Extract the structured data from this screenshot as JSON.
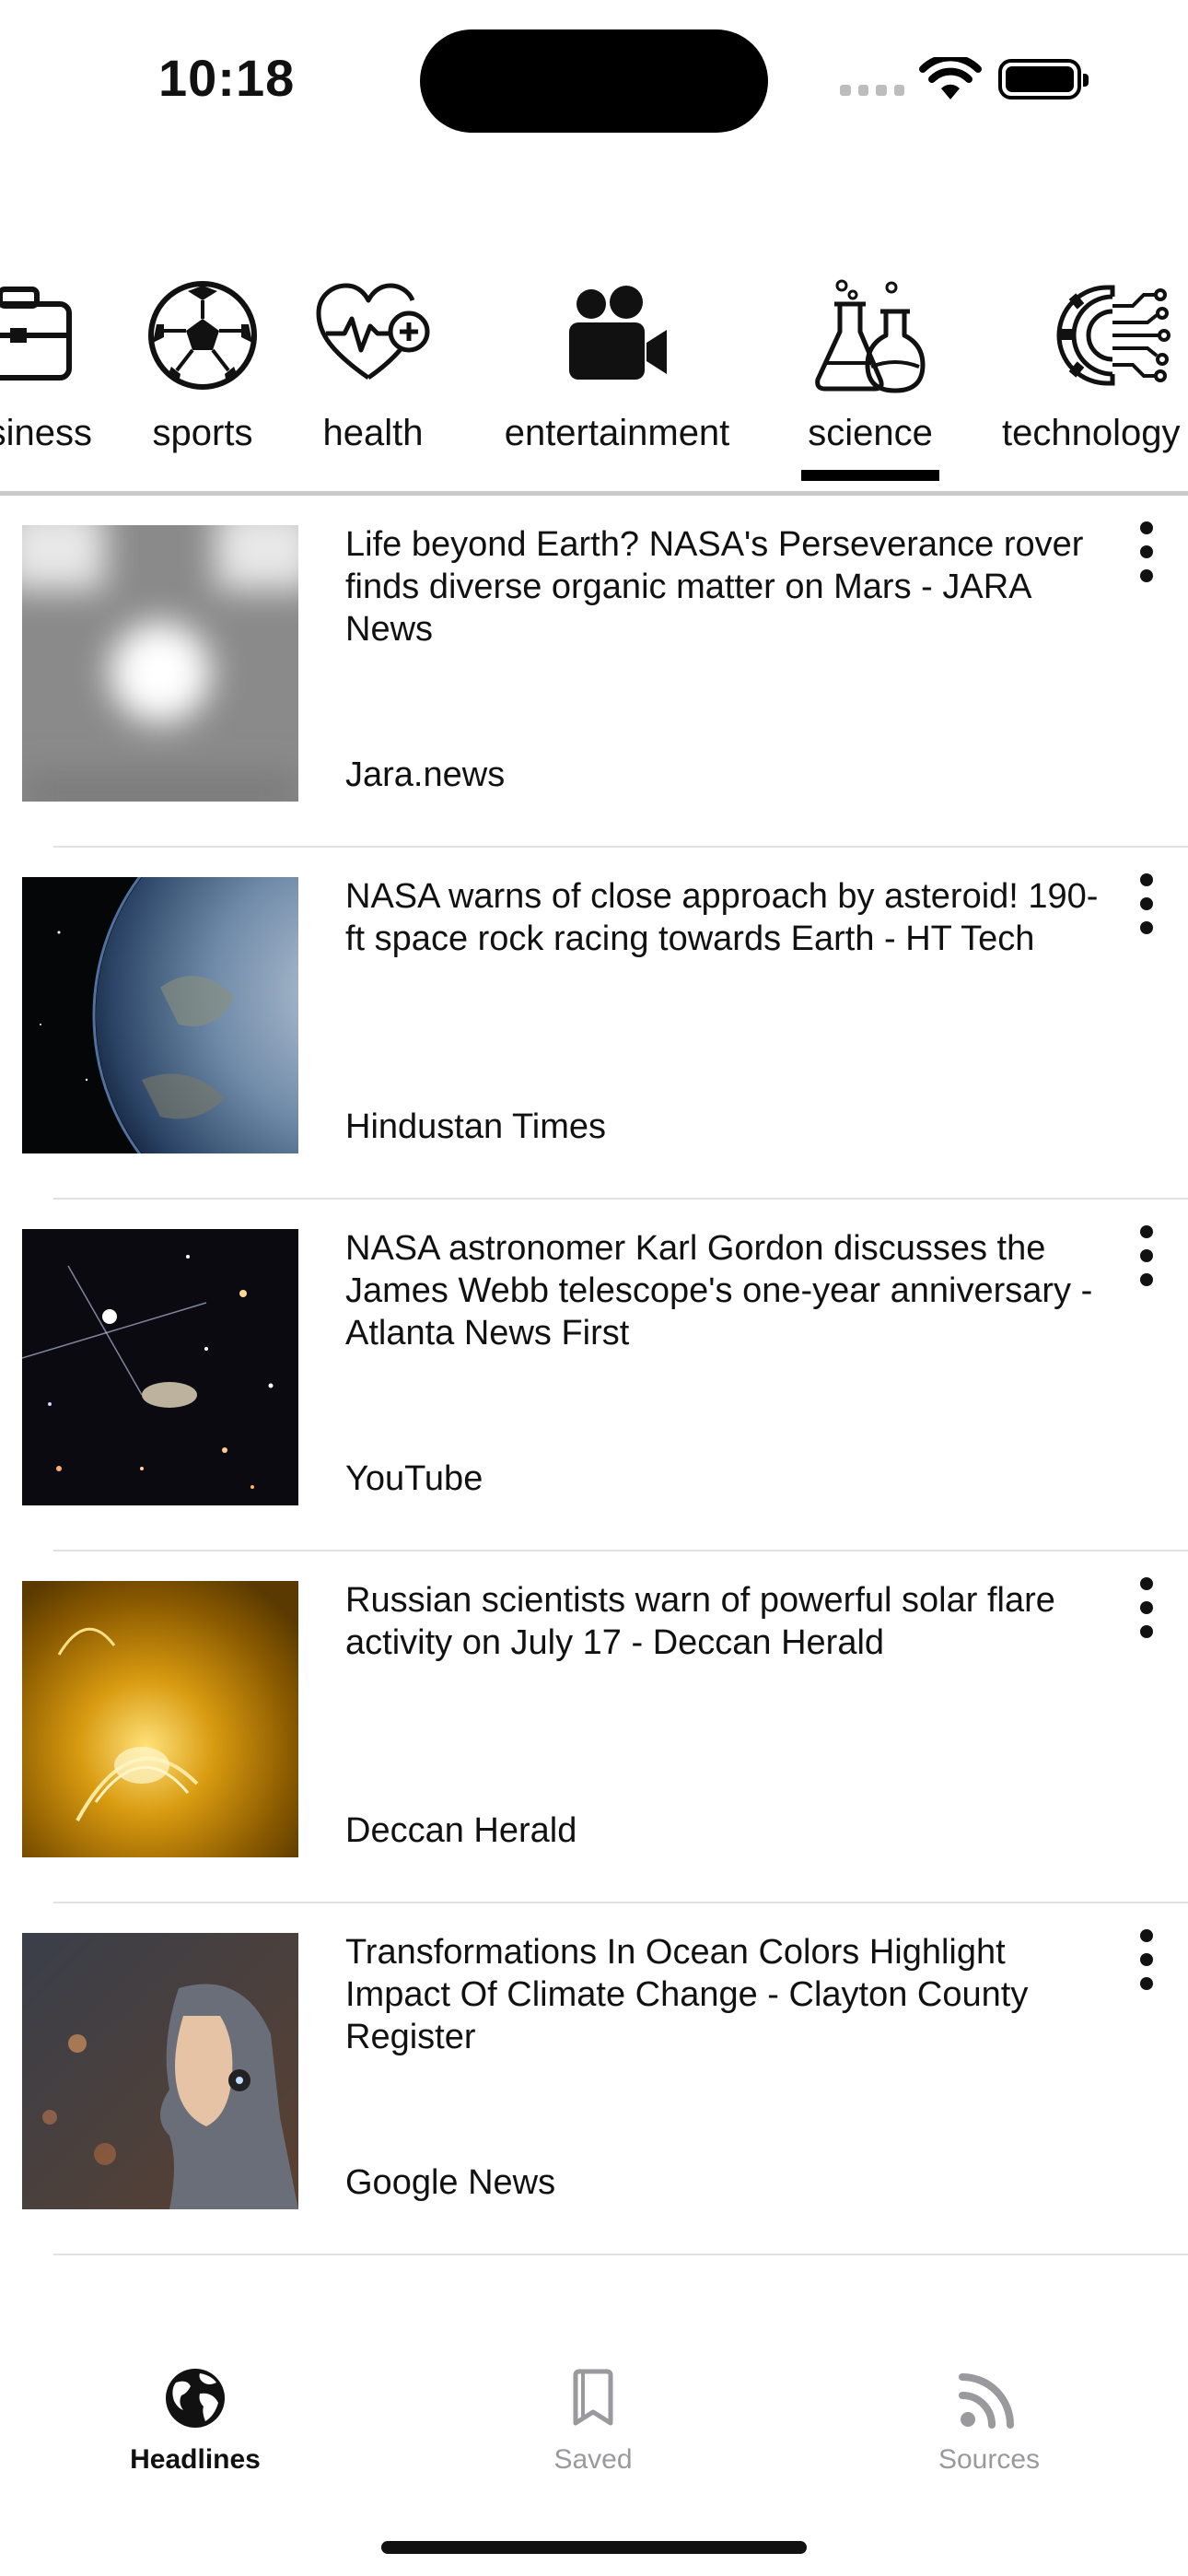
{
  "status": {
    "time": "10:18"
  },
  "categories": [
    {
      "label": "business",
      "icon": "briefcase-icon"
    },
    {
      "label": "sports",
      "icon": "soccer-ball-icon"
    },
    {
      "label": "health",
      "icon": "heart-pulse-icon"
    },
    {
      "label": "entertainment",
      "icon": "video-camera-icon"
    },
    {
      "label": "science",
      "icon": "flasks-icon",
      "selected": true
    },
    {
      "label": "technology",
      "icon": "circuit-gear-icon"
    }
  ],
  "articles": [
    {
      "title": "Life beyond Earth? NASA's Perseverance rover finds diverse organic matter on Mars - JARA News",
      "source": "Jara.news",
      "thumb": "placeholder"
    },
    {
      "title": "NASA warns of close approach by asteroid! 190-ft space rock racing towards Earth - HT Tech",
      "source": "Hindustan Times",
      "thumb": "earth"
    },
    {
      "title": "NASA astronomer Karl Gordon discusses the James Webb telescope's one-year anniversary - Atlanta News First",
      "source": "YouTube",
      "thumb": "galaxy"
    },
    {
      "title": "Russian scientists warn of powerful solar flare activity on July 17 - Deccan Herald",
      "source": "Deccan Herald",
      "thumb": "sun"
    },
    {
      "title": "Transformations In Ocean Colors Highlight Impact Of Climate Change - Clayton County Register",
      "source": "Google News",
      "thumb": "robot"
    }
  ],
  "tabs": [
    {
      "label": "Headlines",
      "icon": "globe-icon",
      "active": true
    },
    {
      "label": "Saved",
      "icon": "bookmark-icon",
      "active": false
    },
    {
      "label": "Sources",
      "icon": "rss-icon",
      "active": false
    }
  ],
  "colors": {
    "accent": "#000000",
    "inactive": "#9a9a9e",
    "divider": "#c9c9cc"
  }
}
